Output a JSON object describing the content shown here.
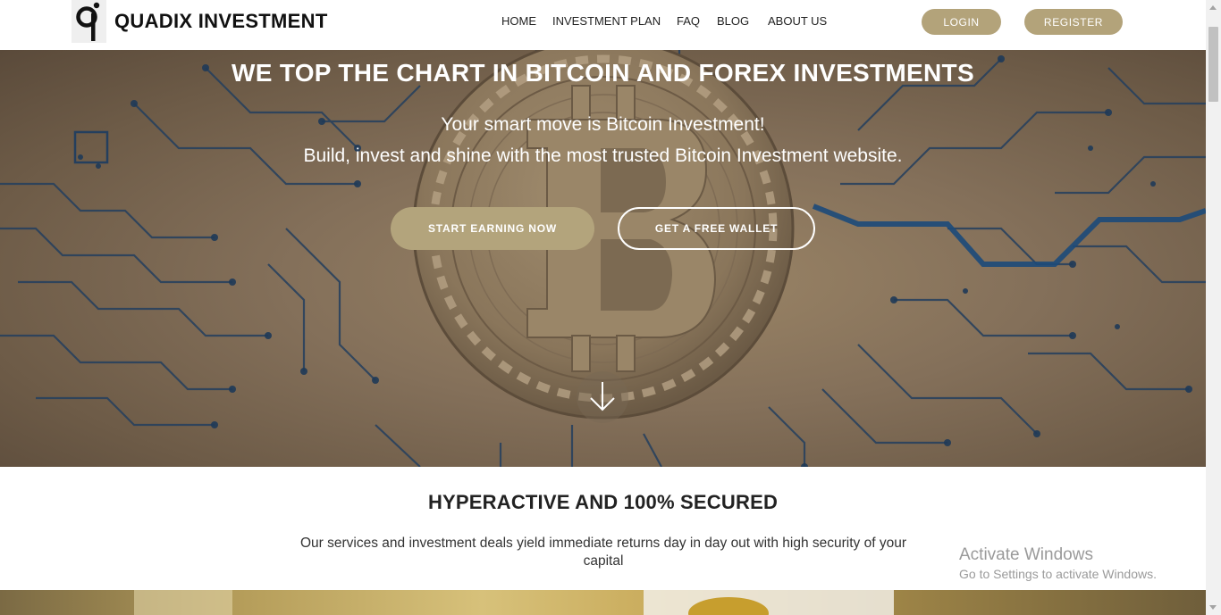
{
  "header": {
    "brand": "QUADIX INVESTMENT",
    "nav": [
      {
        "label": "HOME"
      },
      {
        "label": "INVESTMENT PLAN"
      },
      {
        "label": "FAQ"
      },
      {
        "label": "BLOG"
      },
      {
        "label": "ABOUT US"
      }
    ],
    "login_label": "LOGIN",
    "register_label": "REGISTER"
  },
  "hero": {
    "title": "WE TOP THE CHART IN BITCOIN AND FOREX INVESTMENTS",
    "subtitle_line1": "Your smart move is Bitcoin Investment!",
    "subtitle_line2": "Build, invest and shine with the most trusted Bitcoin Investment website.",
    "start_button": "START EARNING NOW",
    "wallet_button": "GET A FREE WALLET"
  },
  "section": {
    "title": "HYPERACTIVE AND 100% SECURED",
    "text": "Our services and investment deals yield immediate returns day in day out with high security of your capital"
  },
  "watermark": {
    "title": "Activate Windows",
    "text": "Go to Settings to activate Windows."
  },
  "colors": {
    "accent": "#b3a37a",
    "hero_circuit": "#1f3e63"
  }
}
